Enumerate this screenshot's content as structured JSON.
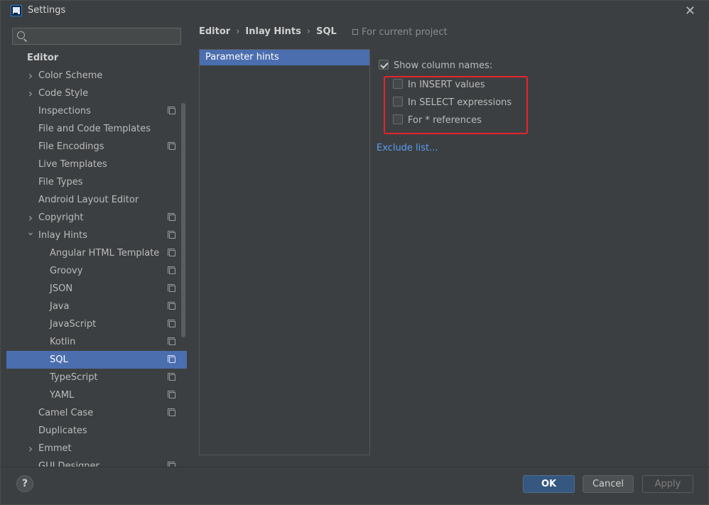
{
  "window": {
    "title": "Settings",
    "close_glyph": "✕"
  },
  "sidebar": {
    "search": {
      "value": "",
      "placeholder": ""
    },
    "items": [
      {
        "label": "Editor",
        "kind": "header"
      },
      {
        "label": "Color Scheme",
        "level": 1,
        "arrow": "right"
      },
      {
        "label": "Code Style",
        "level": 1,
        "arrow": "right"
      },
      {
        "label": "Inspections",
        "level": 1,
        "project_icon": true
      },
      {
        "label": "File and Code Templates",
        "level": 1
      },
      {
        "label": "File Encodings",
        "level": 1,
        "project_icon": true
      },
      {
        "label": "Live Templates",
        "level": 1
      },
      {
        "label": "File Types",
        "level": 1
      },
      {
        "label": "Android Layout Editor",
        "level": 1
      },
      {
        "label": "Copyright",
        "level": 1,
        "arrow": "right",
        "project_icon": true
      },
      {
        "label": "Inlay Hints",
        "level": 1,
        "arrow": "down",
        "project_icon": true
      },
      {
        "label": "Angular HTML Template",
        "level": 2,
        "project_icon": true
      },
      {
        "label": "Groovy",
        "level": 2,
        "project_icon": true
      },
      {
        "label": "JSON",
        "level": 2,
        "project_icon": true
      },
      {
        "label": "Java",
        "level": 2,
        "project_icon": true
      },
      {
        "label": "JavaScript",
        "level": 2,
        "project_icon": true
      },
      {
        "label": "Kotlin",
        "level": 2,
        "project_icon": true
      },
      {
        "label": "SQL",
        "level": 2,
        "project_icon": true,
        "selected": true
      },
      {
        "label": "TypeScript",
        "level": 2,
        "project_icon": true
      },
      {
        "label": "YAML",
        "level": 2,
        "project_icon": true
      },
      {
        "label": "Camel Case",
        "level": 1,
        "project_icon": true
      },
      {
        "label": "Duplicates",
        "level": 1
      },
      {
        "label": "Emmet",
        "level": 1,
        "arrow": "right"
      },
      {
        "label": "GUI Designer",
        "level": 1,
        "project_icon": true
      }
    ]
  },
  "breadcrumb": {
    "items": [
      "Editor",
      "Inlay Hints",
      "SQL"
    ],
    "separator": "›",
    "scope_label": "For current project"
  },
  "hints_list": {
    "items": [
      "Parameter hints"
    ]
  },
  "options": {
    "show_column_names": {
      "label": "Show column names:",
      "checked": true
    },
    "in_insert_values": {
      "label": "In INSERT values",
      "checked": false
    },
    "in_select_expressions": {
      "label": "In SELECT expressions",
      "checked": false
    },
    "for_star_references": {
      "label": "For * references",
      "checked": false
    },
    "exclude_list_link": "Exclude list..."
  },
  "footer": {
    "help_label": "?",
    "ok_label": "OK",
    "cancel_label": "Cancel",
    "apply_label": "Apply"
  },
  "colors": {
    "background": "#3c3f41",
    "selection": "#4b6eaf",
    "link": "#589df6",
    "highlight_box": "#e5252b",
    "ok_button": "#365880"
  }
}
